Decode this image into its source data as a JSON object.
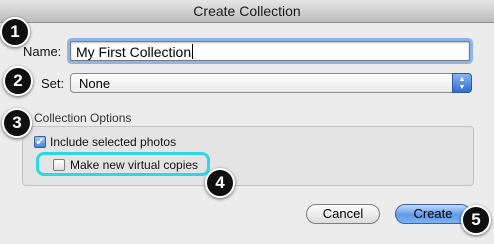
{
  "window": {
    "title": "Create Collection"
  },
  "form": {
    "name_label": "Name:",
    "name_value": "My First Collection",
    "set_label": "Set:",
    "set_value": "None"
  },
  "options": {
    "section_label": "Collection Options",
    "include_selected": {
      "label": "Include selected photos",
      "checked": true
    },
    "make_virtual_copies": {
      "label": "Make new virtual copies",
      "checked": false
    }
  },
  "buttons": {
    "cancel": "Cancel",
    "create": "Create"
  },
  "callouts": [
    "1",
    "2",
    "3",
    "4",
    "5"
  ],
  "colors": {
    "highlight": "#2ed7e6",
    "default_button": "#5d9ae6",
    "badge": "#0f0f0f"
  }
}
